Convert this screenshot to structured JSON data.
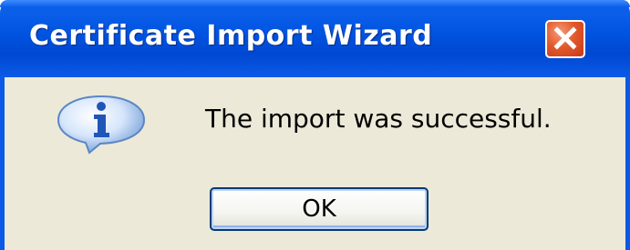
{
  "window": {
    "title": "Certificate Import Wizard"
  },
  "titlebar": {
    "close_icon": "close-icon",
    "close_color": "#d9471f"
  },
  "message": {
    "icon": "info-icon",
    "text": "The import was successful."
  },
  "buttons": {
    "ok_label": "OK"
  },
  "colors": {
    "titlebar": "#0053e0",
    "dialog_background": "#ece9d8",
    "button_border": "#003c74"
  }
}
